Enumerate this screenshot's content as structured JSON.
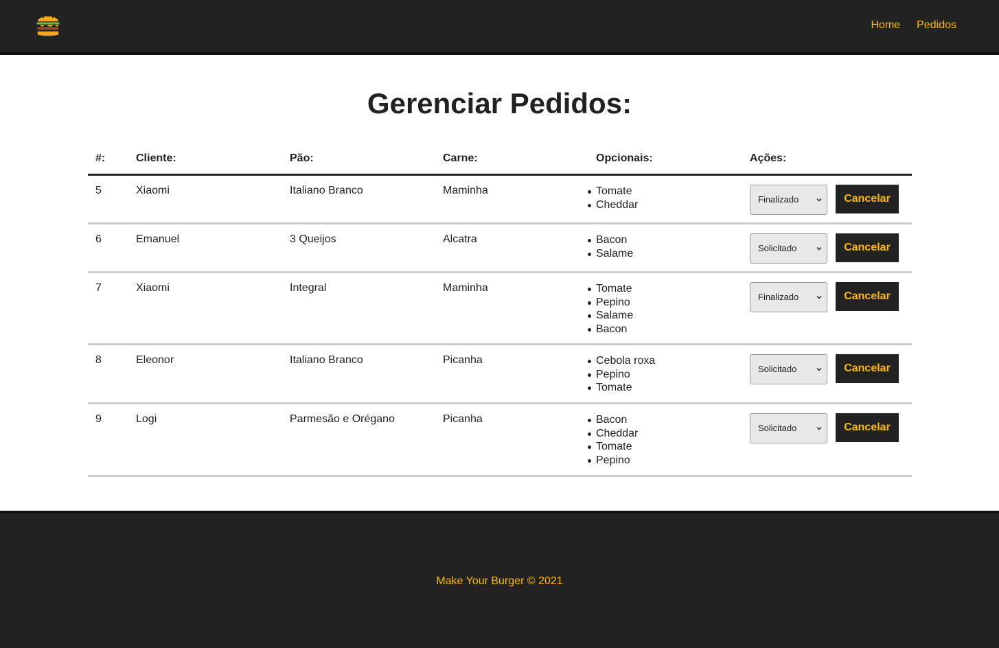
{
  "nav": {
    "logo_icon": "burger-icon",
    "links": [
      "Home",
      "Pedidos"
    ]
  },
  "page_title": "Gerenciar Pedidos:",
  "table": {
    "headers": [
      "#:",
      "Cliente:",
      "Pão:",
      "Carne:",
      "Opcionais:",
      "Ações:"
    ],
    "rows": [
      {
        "id": "5",
        "cliente": "Xiaomi",
        "pao": "Italiano Branco",
        "carne": "Maminha",
        "opcionais": [
          "Tomate",
          "Cheddar"
        ],
        "status": "Finalizado",
        "cancel_label": "Cancelar"
      },
      {
        "id": "6",
        "cliente": "Emanuel",
        "pao": "3 Queijos",
        "carne": "Alcatra",
        "opcionais": [
          "Bacon",
          "Salame"
        ],
        "status": "Solicitado",
        "cancel_label": "Cancelar"
      },
      {
        "id": "7",
        "cliente": "Xiaomi",
        "pao": "Integral",
        "carne": "Maminha",
        "opcionais": [
          "Tomate",
          "Pepino",
          "Salame",
          "Bacon"
        ],
        "status": "Finalizado",
        "cancel_label": "Cancelar"
      },
      {
        "id": "8",
        "cliente": "Eleonor",
        "pao": "Italiano Branco",
        "carne": "Picanha",
        "opcionais": [
          "Cebola roxa",
          "Pepino",
          "Tomate"
        ],
        "status": "Solicitado",
        "cancel_label": "Cancelar"
      },
      {
        "id": "9",
        "cliente": "Logi",
        "pao": "Parmesão e Orégano",
        "carne": "Picanha",
        "opcionais": [
          "Bacon",
          "Cheddar",
          "Tomate",
          "Pepino"
        ],
        "status": "Solicitado",
        "cancel_label": "Cancelar"
      }
    ]
  },
  "footer": {
    "text": "Make Your Burger © 2021"
  },
  "colors": {
    "accent": "#fcba03",
    "dark": "#222222",
    "divider": "#cccccc"
  }
}
